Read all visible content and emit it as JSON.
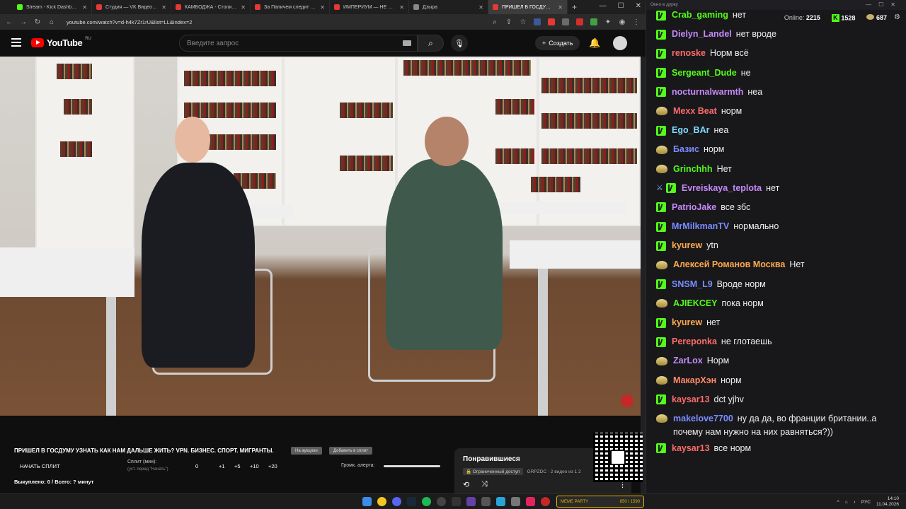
{
  "browser": {
    "tabs": [
      {
        "title": "Stream - Kick Dashboard",
        "color": "#53fc18"
      },
      {
        "title": "Студия — VK Видео Live",
        "color": "#e53935"
      },
      {
        "title": "КАМБОДЖА - Столица Ми",
        "color": "#e53935"
      },
      {
        "title": "За Папичем следит в реаль",
        "color": "#e53935"
      },
      {
        "title": "ИМПЕРИУМ — НЕ РОССИЯ",
        "color": "#e53935"
      },
      {
        "title": "Дзыра",
        "color": "#888888"
      },
      {
        "title": "ПРИШЕЛ В ГОСДУМУ УЗНА",
        "color": "#e53935",
        "active": true
      }
    ],
    "url": "youtube.com/watch?v=d-h4k7Zr1rU&list=LL&index=2"
  },
  "youtube": {
    "logo_text": "YouTube",
    "logo_region": "RU",
    "search_placeholder": "Введите запрос",
    "create_label": "Создать"
  },
  "video": {
    "title": "ПРИШЕЛ В ГОСДУМУ УЗНАТЬ КАК НАМ ДАЛЬШЕ ЖИТЬ? VPN. БИЗНЕС. СПОРТ. МИГРАНТЫ.",
    "chip1": "На аукцион",
    "chip2": "Добавить в сплит",
    "split_button": "НАЧАТЬ СПЛИТ",
    "split_label": "Сплит (мин):",
    "split_hint": "(уст. перед \"Начать\")",
    "split_values": [
      "0",
      "+1",
      "+5",
      "+10",
      "+20"
    ],
    "alert_volume_label": "Громк. алерта:",
    "alert_volume": 1.0,
    "bought": "Выкуплено: 0 / Всего: ? минут"
  },
  "liked": {
    "title": "Понравившиеся",
    "access": "Ограниченный доступ",
    "meta": "GRPZDC · 2 видео из 1 2"
  },
  "chat": {
    "window_title": "Окно в дурку",
    "online_label": "Online:",
    "online": "2215",
    "kick_count": "1528",
    "vk_count": "687",
    "messages": [
      {
        "badge": "kick",
        "user": "Crab_gaming",
        "color": "#53fc18",
        "text": "нет"
      },
      {
        "badge": "kick",
        "user": "Dielyn_Landel",
        "color": "#c58af9",
        "text": "нет вроде"
      },
      {
        "badge": "kick",
        "user": "renoske",
        "color": "#ff6b6b",
        "text": "Норм всё"
      },
      {
        "badge": "kick",
        "user": "Sergeant_Dude",
        "color": "#53fc18",
        "text": "не"
      },
      {
        "badge": "kick",
        "user": "nocturnalwarmth",
        "color": "#c58af9",
        "text": "неа"
      },
      {
        "badge": "vk",
        "user": "Mexx Beat",
        "color": "#ff6b6b",
        "text": "норм"
      },
      {
        "badge": "kick",
        "user": "Ego_BAr",
        "color": "#7fdbff",
        "text": "неа"
      },
      {
        "badge": "vk",
        "user": "Базис",
        "color": "#7b8cff",
        "text": "норм"
      },
      {
        "badge": "vk",
        "user": "Grinchhh",
        "color": "#53fc18",
        "text": "Нет"
      },
      {
        "badge": "kick-sword",
        "user": "Evreiskaya_teplota",
        "color": "#c58af9",
        "text": "нет"
      },
      {
        "badge": "kick",
        "user": "PatrioJake",
        "color": "#c58af9",
        "text": "все збс"
      },
      {
        "badge": "kick",
        "user": "MrMilkmanTV",
        "color": "#7b8cff",
        "text": "нормально"
      },
      {
        "badge": "kick",
        "user": "kyurew",
        "color": "#ffa94d",
        "text": "ytn"
      },
      {
        "badge": "vk",
        "user": "Алексей Романов Москва",
        "color": "#ffa94d",
        "text": "Нет"
      },
      {
        "badge": "kick",
        "user": "SNSM_L9",
        "color": "#7b8cff",
        "text": "Вроде норм"
      },
      {
        "badge": "vk",
        "user": "AJIEKCEY",
        "color": "#53fc18",
        "text": "пока норм"
      },
      {
        "badge": "kick",
        "user": "kyurew",
        "color": "#ffa94d",
        "text": "нет"
      },
      {
        "badge": "kick",
        "user": "Pereponka",
        "color": "#ff6b6b",
        "text": "не глотаешь"
      },
      {
        "badge": "vk",
        "user": "ZarLox",
        "color": "#c58af9",
        "text": "Норм"
      },
      {
        "badge": "vk",
        "user": "МакарХэн",
        "color": "#ff8a65",
        "text": "норм"
      },
      {
        "badge": "kick",
        "user": "kaysar13",
        "color": "#ff6b6b",
        "text": "dct yjhv"
      },
      {
        "badge": "vk",
        "user": "makelove7700",
        "color": "#7b8cff",
        "text": "ну да да, во франции британии..а почему нам нужно на них равняться?))"
      },
      {
        "badge": "kick",
        "user": "kaysar13",
        "color": "#ff6b6b",
        "text": "все норм"
      }
    ]
  },
  "taskbar": {
    "meme_label": "MEME PARTY",
    "meme_progress": "850 / 1590",
    "lang": "РУС",
    "time": "14:10",
    "date": "11.04.2026"
  }
}
